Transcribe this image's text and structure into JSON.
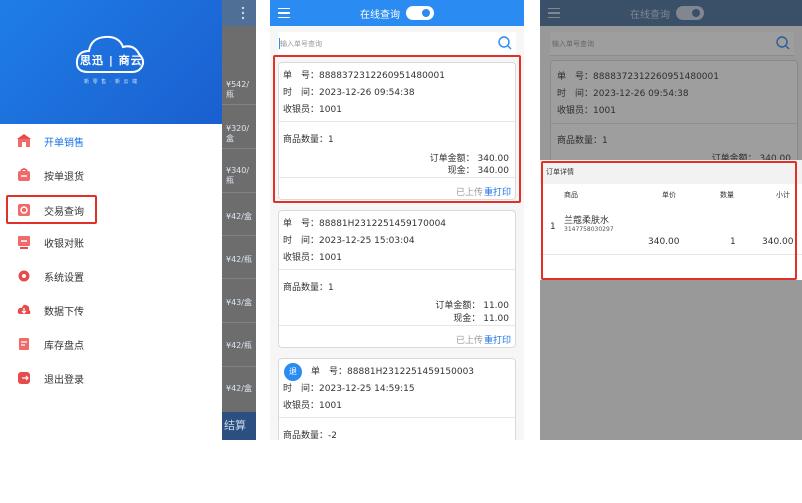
{
  "drawer": {
    "logo_text": "思迅 | 商云",
    "logo_sub": "新 零 售 · 新 云 端",
    "menu": [
      {
        "label": "开单销售",
        "icon": "store-icon",
        "color": "#e84b4b"
      },
      {
        "label": "按单退货",
        "icon": "return-bag-icon",
        "color": "#e84b4b"
      },
      {
        "label": "交易查询",
        "icon": "query-icon",
        "color": "#e84b4b"
      },
      {
        "label": "收银对账",
        "icon": "reconcile-icon",
        "color": "#e84b4b"
      },
      {
        "label": "系统设置",
        "icon": "gear-icon",
        "color": "#e84b4b"
      },
      {
        "label": "数据下传",
        "icon": "cloud-download-icon",
        "color": "#e84b4b"
      },
      {
        "label": "库存盘点",
        "icon": "inventory-icon",
        "color": "#e84b4b"
      },
      {
        "label": "退出登录",
        "icon": "logout-icon",
        "color": "#e84b4b"
      }
    ],
    "background_prices": [
      "¥542/瓶",
      "¥320/盒",
      "¥340/瓶",
      "¥42/盒",
      "¥42/瓶",
      "¥43/盒",
      "¥42/瓶",
      "¥42/盒"
    ],
    "settle_label": "结算"
  },
  "panel2": {
    "title": "在线查询",
    "search_placeholder": "输入单号查询",
    "orders": [
      {
        "no_label": "单　号：",
        "no": "888837231226095148​0001",
        "time_label": "时　间：",
        "time": "2023-12-26 09:54:38",
        "cashier_label": "收银员：",
        "cashier": "1001",
        "qty_label": "商品数量：",
        "qty": "1",
        "amount_label": "订单金额：",
        "amount": "340.00",
        "cash_label": "现金：",
        "cash": "340.00",
        "status": "已上传",
        "reprint": "重打印"
      },
      {
        "no_label": "单　号：",
        "no": "88881H2312251459170004",
        "time_label": "时　间：",
        "time": "2023-12-25 15:03:04",
        "cashier_label": "收银员：",
        "cashier": "1001",
        "qty_label": "商品数量：",
        "qty": "1",
        "amount_label": "订单金额：",
        "amount": "11.00",
        "cash_label": "现金：",
        "cash": "11.00",
        "status": "已上传",
        "reprint": "重打印"
      },
      {
        "no_label": "单　号：",
        "no": "88881H2312251459150003",
        "time_label": "时　间：",
        "time": "2023-12-25 14:59:15",
        "cashier_label": "收银员：",
        "cashier": "1001",
        "qty_label": "商品数量：",
        "qty": "-2",
        "badge": "退"
      }
    ]
  },
  "panel3": {
    "title": "在线查询",
    "search_placeholder": "输入单号查询",
    "order": {
      "no_label": "单　号：",
      "no": "8888372312260951480001",
      "time_label": "时　间：",
      "time": "2023-12-26 09:54:38",
      "cashier_label": "收银员：",
      "cashier": "1001",
      "qty_label": "商品数量：",
      "qty": "1",
      "amount_label": "订单金额：",
      "amount": "340.00"
    },
    "detail": {
      "header": "订单详情",
      "col_item": "商品",
      "col_price": "单价",
      "col_qty": "数量",
      "col_subtotal": "小计",
      "rows": [
        {
          "index": "1",
          "name": "兰蔻柔肤水",
          "code": "3147758030297",
          "price": "340.00",
          "qty": "1",
          "subtotal": "340.00"
        }
      ]
    }
  },
  "colors": {
    "primary": "#2a8bf2",
    "highlight": "#e0302a",
    "link": "#1a73e8"
  }
}
